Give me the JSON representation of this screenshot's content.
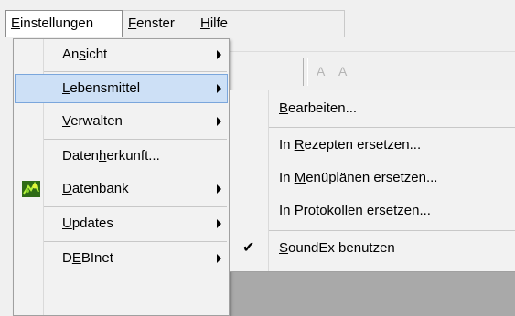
{
  "menubar": {
    "einstellungen": {
      "pre": "",
      "acc": "E",
      "post": "instellungen"
    },
    "fenster": {
      "pre": "",
      "acc": "F",
      "post": "enster"
    },
    "hilfe": {
      "pre": "",
      "acc": "H",
      "post": "ilfe"
    }
  },
  "background": {
    "toolbar_glyph_1": "A",
    "toolbar_glyph_2": "A"
  },
  "menu1": {
    "items": [
      {
        "pre": "An",
        "acc": "s",
        "post": "icht"
      },
      {
        "pre": "",
        "acc": "L",
        "post": "ebensmittel"
      },
      {
        "pre": "",
        "acc": "V",
        "post": "erwalten"
      },
      {
        "pre": "Daten",
        "acc": "h",
        "post": "erkunft..."
      },
      {
        "pre": "",
        "acc": "D",
        "post": "atenbank"
      },
      {
        "pre": "",
        "acc": "U",
        "post": "pdates"
      },
      {
        "pre": "D",
        "acc": "E",
        "post": "BInet"
      }
    ]
  },
  "menu2": {
    "items": [
      {
        "pre": "",
        "acc": "B",
        "post": "earbeiten..."
      },
      {
        "pre": "In ",
        "acc": "R",
        "post": "ezepten ersetzen..."
      },
      {
        "pre": "In ",
        "acc": "M",
        "post": "enüplänen ersetzen..."
      },
      {
        "pre": "In ",
        "acc": "P",
        "post": "rotokollen ersetzen..."
      },
      {
        "pre": "",
        "acc": "S",
        "post": "oundEx benutzen"
      }
    ],
    "check_glyph": "✔"
  },
  "colors": {
    "highlight_bg": "#cde0f6",
    "highlight_border": "#7aa6dc",
    "menu_bg": "#f2f2f2"
  }
}
